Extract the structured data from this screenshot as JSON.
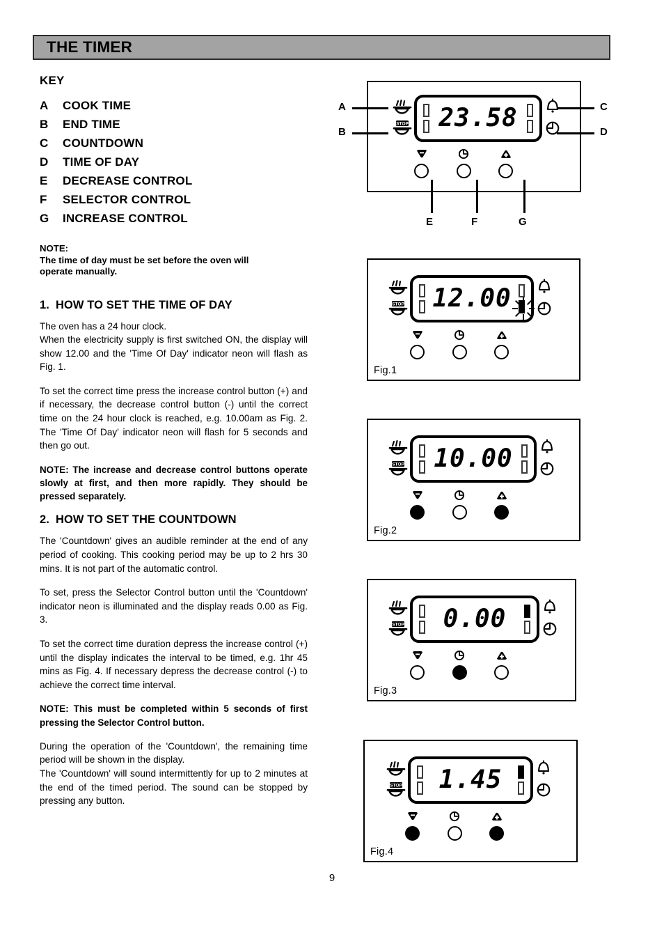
{
  "page": {
    "number": "9",
    "header_title": "THE TIMER"
  },
  "key": {
    "heading": "KEY",
    "items": [
      {
        "letter": "A",
        "label": "COOK TIME"
      },
      {
        "letter": "B",
        "label": "END TIME"
      },
      {
        "letter": "C",
        "label": "COUNTDOWN"
      },
      {
        "letter": "D",
        "label": "TIME OF DAY"
      },
      {
        "letter": "E",
        "label": "DECREASE CONTROL"
      },
      {
        "letter": "F",
        "label": "SELECTOR CONTROL"
      },
      {
        "letter": "G",
        "label": "INCREASE CONTROL"
      }
    ]
  },
  "key_note": {
    "line1": "NOTE:",
    "line2": "The time of day must be set before the oven will",
    "line3": "operate manually."
  },
  "section1": {
    "number": "1.",
    "heading": "HOW TO SET THE TIME OF DAY",
    "p1_line1": "The oven has a 24 hour clock.",
    "p1_line2": "When the electricity supply is first switched ON, the display will show 12.00 and the 'Time Of Day' indicator neon will flash as Fig. 1.",
    "p2": "To set the correct time press the increase control button (+) and if necessary, the decrease control button (-) until the correct time on the 24 hour clock is reached, e.g. 10.00am as Fig. 2.  The 'Time Of Day' indicator neon will flash for 5 seconds and then go out.",
    "note": "NOTE:    The increase and decrease control buttons operate slowly at first, and then more rapidly.  They should be pressed separately."
  },
  "section2": {
    "number": "2.",
    "heading": "HOW TO SET THE COUNTDOWN",
    "p1": "The 'Countdown' gives an audible reminder at the end of any period of cooking.  This cooking period may be  up to 2 hrs 30 mins.  It is not part of the automatic control.",
    "p2": "To set, press the Selector Control button until the 'Countdown' indicator neon is illuminated and the display reads 0.00 as Fig. 3.",
    "p3": "To set the correct time duration depress the increase control (+) until the display indicates the interval to be timed, e.g. 1hr 45 mins as Fig. 4.  If necessary depress the decrease control (-) to achieve the correct time interval.",
    "note": "NOTE:  This must be completed within 5 seconds of first pressing the Selector Control button.",
    "p4_line1": "During the operation of the 'Countdown', the remaining time period will be shown in the display.",
    "p4_line2": "The 'Countdown' will sound intermittently for up to 2 minutes at the end of the timed period.  The sound can be stopped by pressing any button."
  },
  "figures": {
    "main": {
      "display_value": "23.58",
      "callouts": {
        "a": "A",
        "b": "B",
        "c": "C",
        "d": "D",
        "e": "E",
        "f": "F",
        "g": "G"
      },
      "icons": {
        "cook_time": "pot-steam-icon",
        "end_time": "pot-stop-icon",
        "countdown": "bell-icon",
        "time_of_day": "clock-icon",
        "decrease": "triangle-down-minus-icon",
        "selector": "clock-selector-icon",
        "increase": "triangle-up-plus-icon"
      },
      "neons": {
        "top_left": "off",
        "bottom_left": "off",
        "top_right": "off",
        "bottom_right": "off"
      },
      "buttons": {
        "decrease": "released",
        "selector": "released",
        "increase": "released"
      }
    },
    "fig1": {
      "caption": "Fig.1",
      "display_value": "12.00",
      "neons": {
        "top_left": "off",
        "bottom_left": "off",
        "top_right": "off",
        "bottom_right": "flashing"
      },
      "buttons": {
        "decrease": "released",
        "selector": "released",
        "increase": "released"
      }
    },
    "fig2": {
      "caption": "Fig.2",
      "display_value": "10.00",
      "neons": {
        "top_left": "off",
        "bottom_left": "off",
        "top_right": "off",
        "bottom_right": "off"
      },
      "buttons": {
        "decrease": "pressed",
        "selector": "released",
        "increase": "pressed"
      }
    },
    "fig3": {
      "caption": "Fig.3",
      "display_value": "0.00",
      "neons": {
        "top_left": "off",
        "bottom_left": "off",
        "top_right": "on",
        "bottom_right": "off"
      },
      "buttons": {
        "decrease": "released",
        "selector": "pressed",
        "increase": "released"
      }
    },
    "fig4": {
      "caption": "Fig.4",
      "display_value": "1.45",
      "neons": {
        "top_left": "off",
        "bottom_left": "off",
        "top_right": "on",
        "bottom_right": "off"
      },
      "buttons": {
        "decrease": "pressed",
        "selector": "released",
        "increase": "pressed"
      }
    }
  }
}
